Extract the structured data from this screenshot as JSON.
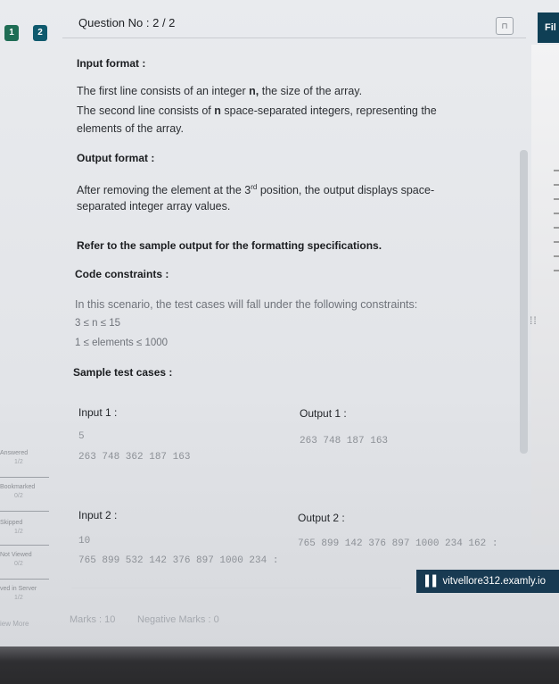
{
  "nav": {
    "questions": [
      "1",
      "2"
    ],
    "header_title": "Question No : 2 / 2",
    "finish_label": "Fil"
  },
  "content": {
    "input_format_heading": "Input format :",
    "input_line1_a": "The first line consists of an integer ",
    "input_line1_b": "n,",
    "input_line1_c": " the size of the array.",
    "input_line2_a": "The second line consists of ",
    "input_line2_b": "n",
    "input_line2_c": " space-separated integers, representing the",
    "input_line3": "elements of the array.",
    "output_format_heading": "Output format :",
    "output_line1_a": "After removing the element at the 3",
    "output_line1_sup": "rd",
    "output_line1_b": " position, the output displays space-",
    "output_line2": "separated integer array values.",
    "refer_text": "Refer to the sample output for the formatting specifications.",
    "constraints_heading": "Code constraints :",
    "constraints_intro": "In this scenario, the test cases will fall under the following constraints:",
    "constraint1": "3 ≤ n ≤ 15",
    "constraint2": "1 ≤ elements ≤ 1000",
    "sample_heading": "Sample test cases :",
    "input1_label": "Input 1 :",
    "input1_line1": "5",
    "input1_line2": "263  748  362  187  163",
    "output1_label": "Output 1 :",
    "output1_line1": "263  748  187  163",
    "input2_label": "Input 2 :",
    "input2_line1": "10",
    "input2_line2": "765  899  532  142  376  897  1000  234  :",
    "output2_label": "Output 2 :",
    "output2_line1": "765  899  142  376  897  1000  234  162  :"
  },
  "legend": [
    {
      "label": "Answered",
      "count": "1/2"
    },
    {
      "label": "Bookmarked",
      "count": "0/2"
    },
    {
      "label": "Skipped",
      "count": "1/2"
    },
    {
      "label": "Not Viewed",
      "count": "0/2"
    },
    {
      "label": "ved in Server",
      "count": "1/2"
    }
  ],
  "footer": {
    "view_more": "iew More",
    "marks": "Marks : 10",
    "negative_marks": "Negative Marks : 0"
  },
  "watermark": "▌▌ vitvellore312.examly.io",
  "colors": {
    "question_1": "#1f6d55",
    "question_2": "#0f5a6e",
    "finish": "#0f3f55"
  }
}
